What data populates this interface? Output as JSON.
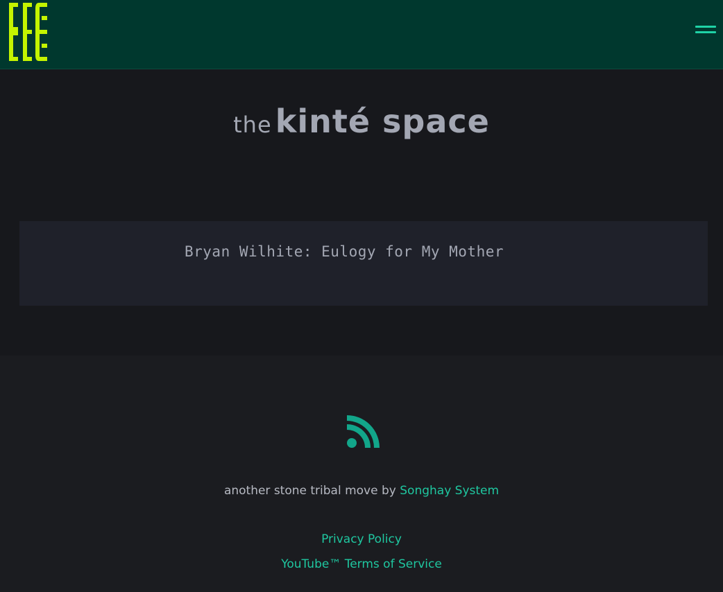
{
  "header": {
    "logo_icon": "stone-logo-icon",
    "menu_icon": "hamburger-menu-icon",
    "colors": {
      "background": "#00382e",
      "logo": "#c4f400",
      "menu": "#1fd2a6"
    }
  },
  "site_title": {
    "prefix": "the",
    "main": "kinté space"
  },
  "posts": [
    {
      "title": "Bryan Wilhite: Eulogy for My Mother"
    }
  ],
  "footer": {
    "rss_icon": "rss-feed-icon",
    "credit_text": "another stone tribal move by ",
    "credit_link": "Songhay System",
    "links": [
      {
        "label": "Privacy Policy"
      },
      {
        "label": "YouTube™ Terms of Service"
      }
    ],
    "colors": {
      "accent": "#1fc7a0",
      "rss": "#12a68a"
    }
  }
}
